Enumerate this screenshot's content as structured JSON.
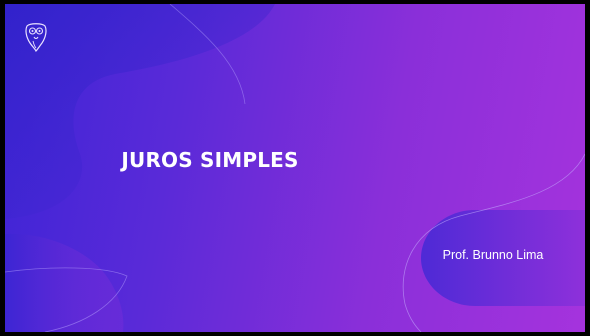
{
  "slide": {
    "title": "JUROS SIMPLES",
    "author": "Prof. Brunno Lima",
    "logo_icon": "owl-icon"
  },
  "colors": {
    "frame": "#000000",
    "gradient_start": "#3d24d6",
    "gradient_end": "#a533dd",
    "text": "#ffffff"
  }
}
